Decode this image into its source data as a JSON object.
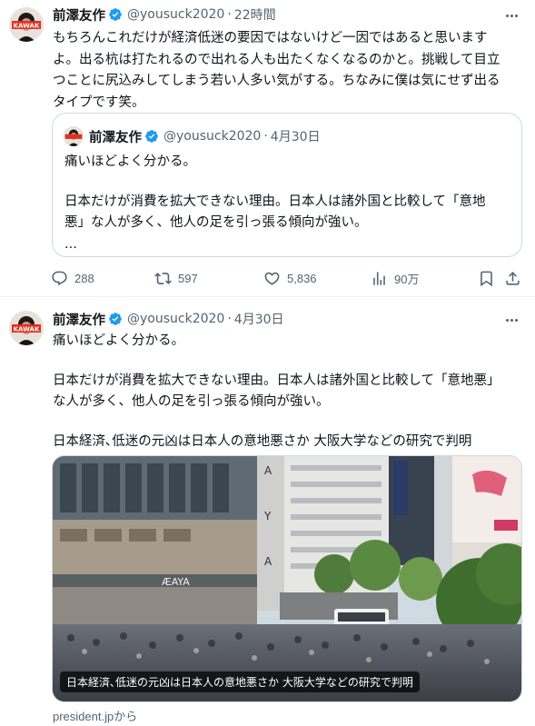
{
  "tweet1": {
    "author_name": "前澤友作",
    "handle": "@yousuck2020",
    "separator": "·",
    "time": "22時間",
    "text_lines": [
      "もちろんこれだけが経済低迷の要因ではないけど一因ではあると思います",
      "よ。出る杭は打たれるので出れる人も出たくなくなるのかと。挑戦して目立",
      "つことに尻込みしてしまう若い人多い気がする。ちなみに僕は気にせず出る",
      "タイプです笑。"
    ],
    "quote": {
      "author_name": "前澤友作",
      "handle": "@yousuck2020",
      "separator": "·",
      "time": "4月30日",
      "line1": "痛いほどよく分かる。",
      "line2": "日本だけが消費を拡大できない理由。日本人は諸外国と比較して「意地",
      "line3": "悪」な人が多く、他人の足を引っ張る傾向が強い。",
      "line4": "..."
    },
    "actions": {
      "replies": "288",
      "retweets": "597",
      "likes": "5,836",
      "views": "90万"
    }
  },
  "tweet2": {
    "author_name": "前澤友作",
    "handle": "@yousuck2020",
    "separator": "·",
    "time": "4月30日",
    "line1": "痛いほどよく分かる。",
    "line2": "日本だけが消費を拡大できない理由。日本人は諸外国と比較して「意地悪」",
    "line3": "な人が多く、他人の足を引っ張る傾向が強い。",
    "line4": "日本経済､低迷の元凶は日本人の意地悪さか 大阪大学などの研究で判明",
    "card": {
      "caption": "日本経済､低迷の元凶は日本人の意地悪さか 大阪大学などの研究で判明",
      "source": "president.jpから"
    }
  },
  "colors": {
    "verified": "#1d9bf0",
    "secondary_text": "#536471",
    "border": "#cfd9de"
  },
  "icons": [
    "verified-badge-icon",
    "more-icon",
    "reply-icon",
    "retweet-icon",
    "like-icon",
    "views-icon",
    "bookmark-icon",
    "share-icon"
  ]
}
